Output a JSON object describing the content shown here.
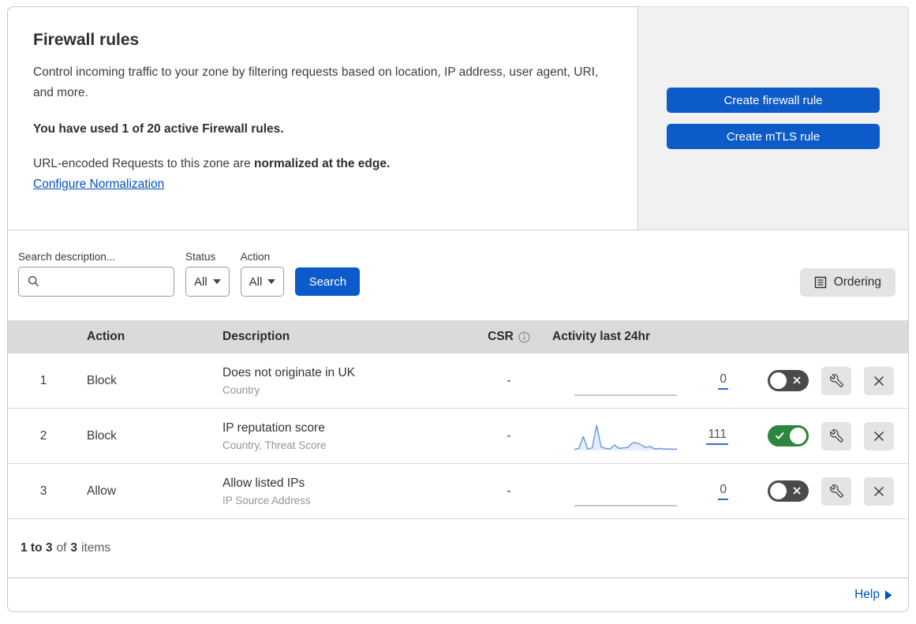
{
  "intro": {
    "title": "Firewall rules",
    "description": "Control incoming traffic to your zone by filtering requests based on location, IP address, user agent, URI, and more.",
    "usage": "You have used 1 of 20 active Firewall rules.",
    "normalization_prefix": "URL-encoded Requests to this zone are ",
    "normalization_bold": "normalized at the edge.",
    "normalization_link": "Configure Normalization"
  },
  "actions": {
    "create_firewall_rule": "Create firewall rule",
    "create_mtls_rule": "Create mTLS rule"
  },
  "filters": {
    "search_label": "Search description...",
    "status_label": "Status",
    "status_value": "All",
    "action_label": "Action",
    "action_value": "All",
    "search_button": "Search",
    "ordering_button": "Ordering"
  },
  "table": {
    "headers": {
      "action": "Action",
      "description": "Description",
      "csr": "CSR",
      "activity": "Activity last 24hr"
    },
    "rows": [
      {
        "priority": "1",
        "action": "Block",
        "description": "Does not originate in UK",
        "fields": "Country",
        "csr": "-",
        "count": "0",
        "enabled": false,
        "sparkline": [
          0,
          0,
          0,
          0,
          0,
          0,
          0,
          0,
          0,
          0,
          0,
          0,
          0,
          0,
          0,
          0,
          0,
          0,
          0,
          0,
          0,
          0,
          0,
          0
        ]
      },
      {
        "priority": "2",
        "action": "Block",
        "description": "IP reputation score",
        "fields": "Country, Threat Score",
        "csr": "-",
        "count": "111",
        "enabled": true,
        "sparkline": [
          4,
          8,
          55,
          6,
          10,
          100,
          14,
          8,
          6,
          22,
          8,
          10,
          12,
          30,
          30,
          22,
          12,
          16,
          6,
          8,
          6,
          6,
          5,
          5
        ]
      },
      {
        "priority": "3",
        "action": "Allow",
        "description": "Allow listed IPs",
        "fields": "IP Source Address",
        "csr": "-",
        "count": "0",
        "enabled": false,
        "sparkline": [
          0,
          0,
          0,
          0,
          0,
          0,
          0,
          0,
          0,
          0,
          0,
          0,
          0,
          0,
          0,
          0,
          0,
          0,
          0,
          0,
          0,
          0,
          0,
          0
        ]
      }
    ]
  },
  "pagination": {
    "range": "1 to 3",
    "of_text": "of",
    "total": "3",
    "items_text": "items"
  },
  "help": {
    "label": "Help"
  },
  "colors": {
    "button_blue": "#0d5bc8",
    "link_blue": "#0051c3",
    "toggle_on_green": "#2e8540",
    "toggle_off_gray": "#4a4a4a",
    "sparkline_blue": "#6f9ce3",
    "sparkline_flat_gray": "#b5b5b5",
    "header_gray": "#dadada",
    "panel_gray": "#f1f1f2"
  }
}
